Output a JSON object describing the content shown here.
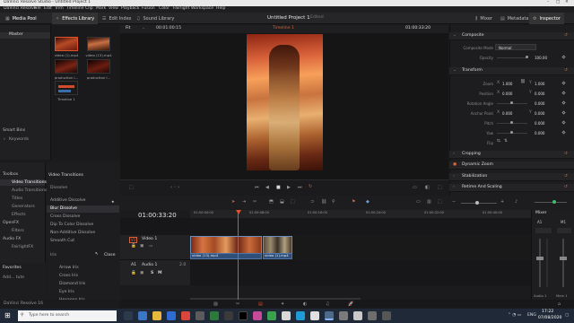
{
  "window": {
    "title": "DaVinci Resolve Studio - Untitled Project 1"
  },
  "menu": [
    "DaVinci Resolve",
    "File",
    "Edit",
    "Trim",
    "Timeline",
    "Clip",
    "Mark",
    "View",
    "Playback",
    "Fusion",
    "Color",
    "Fairlight",
    "Workspace",
    "Help"
  ],
  "toolbar": {
    "media_pool": "Media Pool",
    "effects_library": "Effects Library",
    "edit_index": "Edit Index",
    "sound_library": "Sound Library",
    "project_title": "Untitled Project 1",
    "project_status": "Edited",
    "mixer": "Mixer",
    "metadata": "Metadata",
    "inspector": "Inspector"
  },
  "media_pool": {
    "master": "Master",
    "clips": [
      {
        "name": "video (1).mp4",
        "selected": true
      },
      {
        "name": "video (13).mp4",
        "selected": false
      },
      {
        "name": "production I...",
        "selected": false
      },
      {
        "name": "production I...",
        "selected": false
      },
      {
        "name": "Timeline 1",
        "selected": false
      }
    ],
    "smart_bins": "Smart Bins",
    "keywords": "Keywords"
  },
  "viewer": {
    "zoom": "Fit",
    "source_tc": "00:01:00:15",
    "timeline_name": "Timeline 1",
    "timecode": "01:00:33:20"
  },
  "inspector": {
    "composite": "Composite",
    "composite_mode_label": "Composite Mode",
    "composite_mode": "Normal",
    "opacity_label": "Opacity",
    "opacity": "100.00",
    "transform": "Transform",
    "zoom_label": "Zoom",
    "zoom_x": "1.000",
    "zoom_y": "1.000",
    "position_label": "Position",
    "position_x": "0.000",
    "position_y": "0.000",
    "rotation_label": "Rotation Angle",
    "rotation": "0.000",
    "anchor_label": "Anchor Point",
    "anchor_x": "0.000",
    "anchor_y": "0.000",
    "pitch_label": "Pitch",
    "pitch": "0.000",
    "yaw_label": "Yaw",
    "yaw": "0.000",
    "flip_label": "Flip",
    "cropping": "Cropping",
    "dynamic_zoom": "Dynamic Zoom",
    "stabilization": "Stabilization",
    "retime": "Retime And Scaling"
  },
  "effects": {
    "toolbox": "Toolbox",
    "video_transitions": "Video Transitions",
    "audio_transitions": "Audio Transitions",
    "titles": "Titles",
    "generators": "Generators",
    "effects": "Effects",
    "openfx": "OpenFX",
    "filters": "Filters",
    "audio_fx": "Audio FX",
    "fairlight_fx": "FairlightFX",
    "favorites": "Favorites",
    "fav_item": "Add... tute",
    "panel_title": "Video Transitions",
    "dissolve": "Dissolve",
    "dissolves": [
      "Additive Dissolve",
      "Blur Dissolve",
      "Cross Dissolve",
      "Dip To Color Dissolve",
      "Non-Additive Dissolve",
      "Smooth Cut"
    ],
    "iris": "Iris",
    "close": "Close",
    "iris_items": [
      "Arrow Iris",
      "Cross Iris",
      "Diamond Iris",
      "Eye Iris",
      "Hexagon Iris"
    ]
  },
  "timeline": {
    "timecode": "01:00:33:20",
    "ruler": [
      "01:00:00:00",
      "01:00:08:00",
      "01:00:16:00",
      "01:00:24:00",
      "01:00:32:00",
      "01:00:40:00"
    ],
    "v1": "V1",
    "video1": "Video 1",
    "a1": "A1",
    "audio1": "Audio 1",
    "a1_level": "2.0",
    "clip1": "video (13).mp4",
    "clip2": "video (1).mp4",
    "audio_clip1": "video (13).mp4",
    "audio_clip2": "video (1).mp4"
  },
  "mixer": {
    "label": "Mixer",
    "a1": "A1",
    "m1": "M1",
    "audio1": "Audio 1",
    "main1": "Main 1"
  },
  "status": {
    "app": "DaVinci Resolve 16"
  },
  "taskbar": {
    "search": "Type here to search",
    "time": "17:22",
    "date": "07/08/2020",
    "lang": "ENG"
  }
}
